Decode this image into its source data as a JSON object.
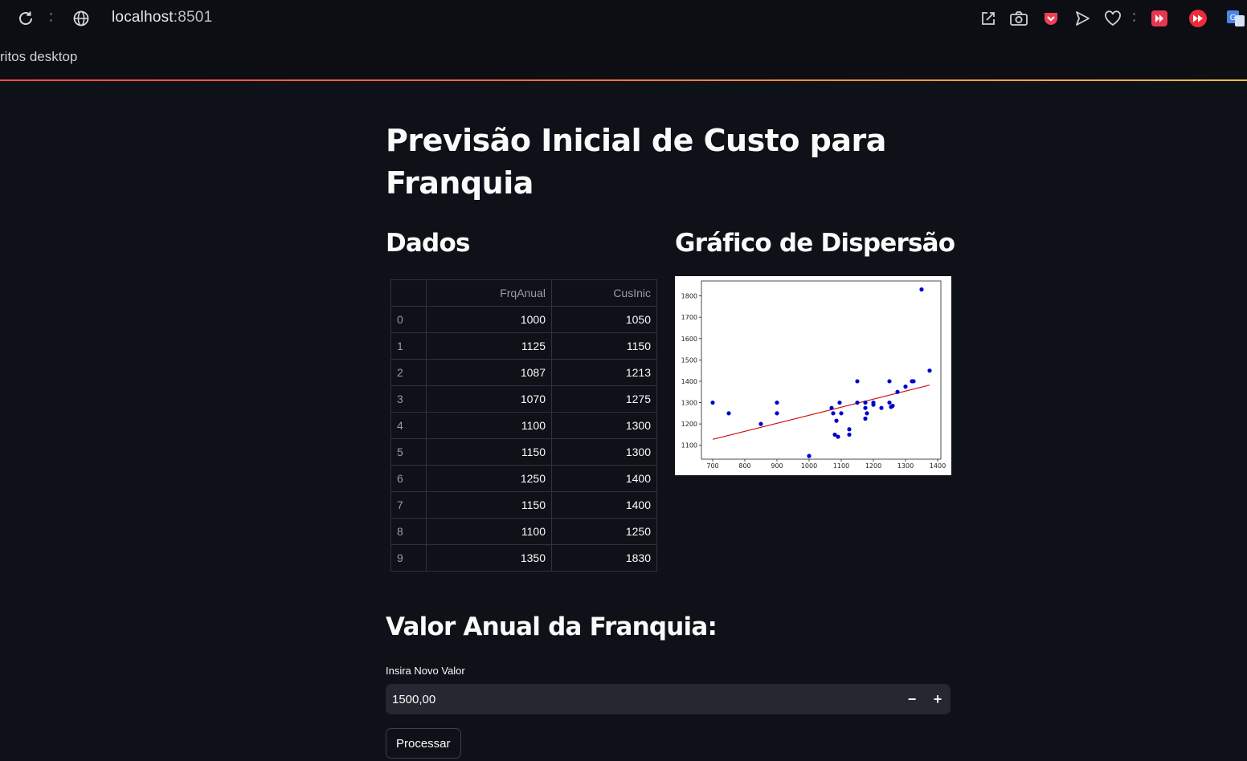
{
  "browser": {
    "url_host": "localhost",
    "url_port": ":8501",
    "bookmark": "ritos desktop"
  },
  "app": {
    "title": "Previsão Inicial de Custo para Franquia",
    "data_header": "Dados",
    "chart_header": "Gráfico de Dispersão",
    "table": {
      "columns": [
        "",
        "FrqAnual",
        "CusInic"
      ],
      "rows": [
        [
          "0",
          "1000",
          "1050"
        ],
        [
          "1",
          "1125",
          "1150"
        ],
        [
          "2",
          "1087",
          "1213"
        ],
        [
          "3",
          "1070",
          "1275"
        ],
        [
          "4",
          "1100",
          "1300"
        ],
        [
          "5",
          "1150",
          "1300"
        ],
        [
          "6",
          "1250",
          "1400"
        ],
        [
          "7",
          "1150",
          "1400"
        ],
        [
          "8",
          "1100",
          "1250"
        ],
        [
          "9",
          "1350",
          "1830"
        ]
      ]
    },
    "input_header": "Valor Anual da Franquia:",
    "input_label": "Insira Novo Valor",
    "input_value": "1500,00",
    "minus_label": "−",
    "plus_label": "+",
    "button_label": "Processar"
  },
  "chart_data": {
    "type": "scatter",
    "title": "",
    "xlabel": "",
    "ylabel": "",
    "xlim": [
      665,
      1410
    ],
    "ylim": [
      1035,
      1870
    ],
    "xticks": [
      700,
      800,
      900,
      1000,
      1100,
      1200,
      1300,
      1400
    ],
    "yticks": [
      1100,
      1200,
      1300,
      1400,
      1500,
      1600,
      1700,
      1800
    ],
    "grid": false,
    "point_color": "#0000cd",
    "line_color": "#cc0000",
    "points": [
      [
        700,
        1300
      ],
      [
        750,
        1250
      ],
      [
        850,
        1200
      ],
      [
        900,
        1300
      ],
      [
        900,
        1250
      ],
      [
        1000,
        1050
      ],
      [
        1070,
        1275
      ],
      [
        1075,
        1250
      ],
      [
        1080,
        1150
      ],
      [
        1085,
        1215
      ],
      [
        1090,
        1140
      ],
      [
        1095,
        1300
      ],
      [
        1100,
        1250
      ],
      [
        1125,
        1175
      ],
      [
        1125,
        1150
      ],
      [
        1150,
        1400
      ],
      [
        1150,
        1300
      ],
      [
        1175,
        1300
      ],
      [
        1175,
        1275
      ],
      [
        1175,
        1225
      ],
      [
        1180,
        1250
      ],
      [
        1200,
        1300
      ],
      [
        1200,
        1290
      ],
      [
        1225,
        1275
      ],
      [
        1250,
        1400
      ],
      [
        1250,
        1300
      ],
      [
        1255,
        1280
      ],
      [
        1260,
        1285
      ],
      [
        1275,
        1350
      ],
      [
        1300,
        1375
      ],
      [
        1320,
        1400
      ],
      [
        1325,
        1400
      ],
      [
        1350,
        1830
      ],
      [
        1375,
        1450
      ]
    ],
    "trendline": {
      "x": [
        700,
        1375
      ],
      "y": [
        1128,
        1382
      ]
    }
  }
}
